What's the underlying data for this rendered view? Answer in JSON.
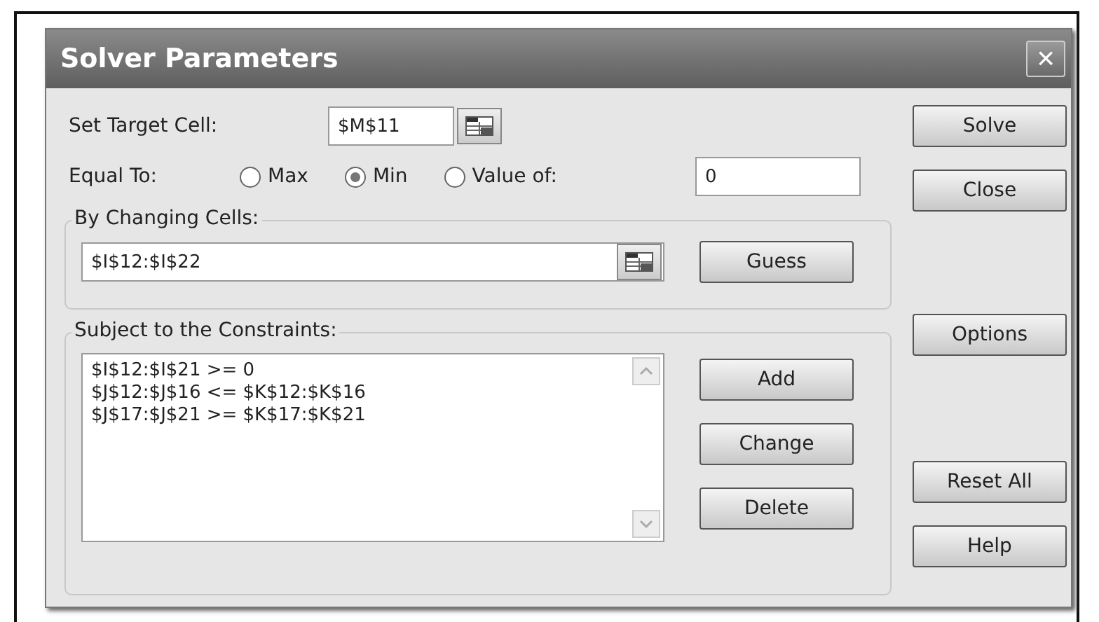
{
  "window": {
    "title": "Solver Parameters",
    "close": "×"
  },
  "target_cell": {
    "label": "Set Target Cell:",
    "value": "$M$11"
  },
  "equal_to": {
    "label": "Equal To:",
    "options": [
      {
        "label": "Max",
        "selected": false
      },
      {
        "label": "Min",
        "selected": true
      },
      {
        "label": "Value of:",
        "selected": false
      }
    ],
    "value": "0"
  },
  "changing_cells": {
    "label": "By Changing Cells:",
    "value": "$I$12:$I$22",
    "button": "Guess"
  },
  "constraints": {
    "label": "Subject to the Constraints:",
    "items": [
      "$I$12:$I$21 >= 0",
      "$J$12:$J$16 <= $K$12:$K$16",
      "$J$17:$J$21 >= $K$17:$K$21"
    ],
    "buttons": [
      "Add",
      "Change",
      "Delete"
    ]
  },
  "side_button_groups": [
    [
      "Solve",
      "Close"
    ],
    [
      "Options"
    ],
    [
      "Reset All",
      "Help"
    ]
  ]
}
